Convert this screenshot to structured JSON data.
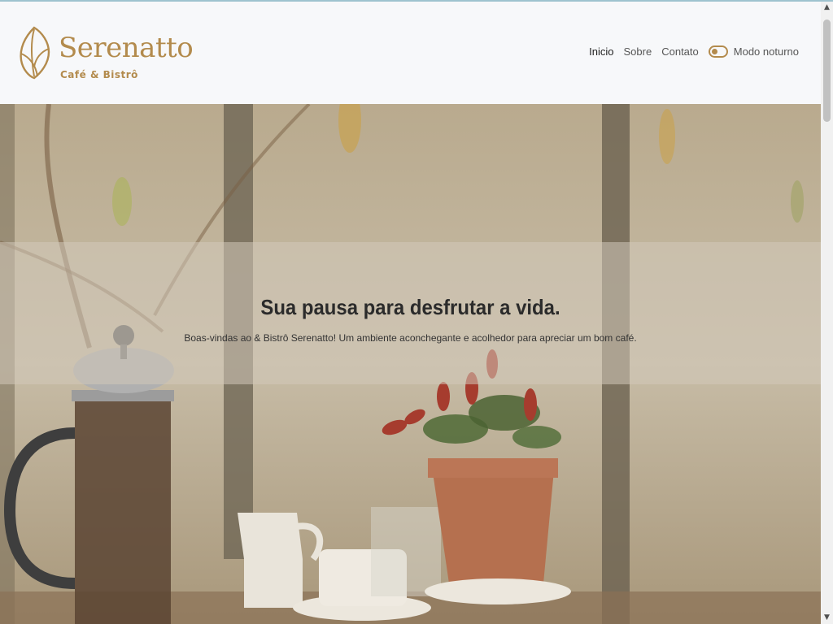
{
  "brand": {
    "name": "Serenatto",
    "subtitle": "Café & Bistrô",
    "color": "#b38b4d"
  },
  "nav": {
    "items": [
      {
        "label": "Inicio",
        "active": true
      },
      {
        "label": "Sobre",
        "active": false
      },
      {
        "label": "Contato",
        "active": false
      }
    ],
    "dark_mode_label": "Modo noturno",
    "dark_mode_on": false
  },
  "hero": {
    "title": "Sua pausa para desfrutar a vida.",
    "text": "Boas-vindas ao & Bistrô Serenatto! Um ambiente aconchegante e acolhedor para apreciar um bom café."
  },
  "icons": {
    "logo": "coffee-bean-leaf-icon",
    "scroll_up": "chevron-up-icon",
    "scroll_down": "chevron-down-icon"
  }
}
